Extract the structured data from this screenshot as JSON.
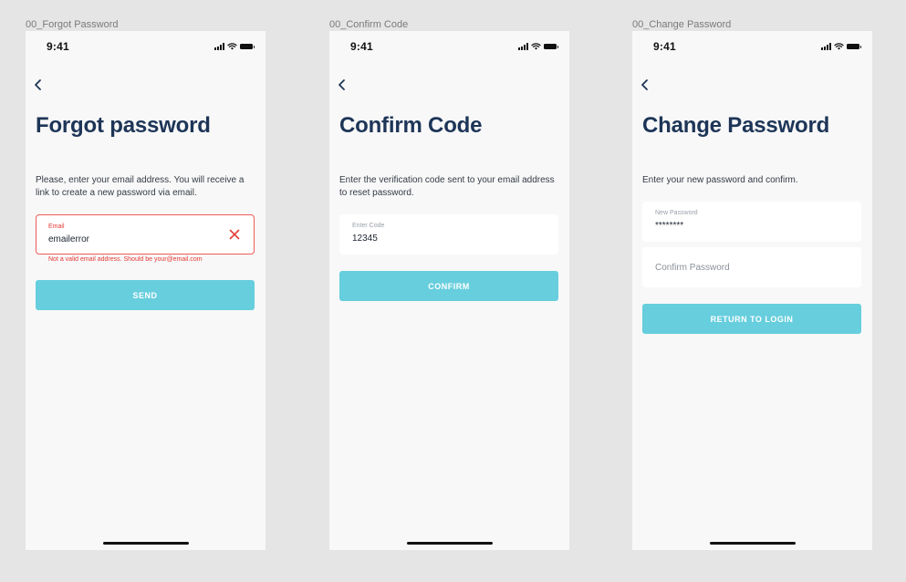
{
  "frames": [
    {
      "label": "00_Forgot Password",
      "time": "9:41",
      "title": "Forgot password",
      "description": "Please, enter your email address. You will receive a link to create a new password via email.",
      "email_field": {
        "label": "Email",
        "value": "emailerror"
      },
      "error_message": "Not a valid email address. Should be your@email.com",
      "button_label": "SEND"
    },
    {
      "label": "00_Confirm Code",
      "time": "9:41",
      "title": "Confirm Code",
      "description": "Enter the verification code sent to your email address to reset password.",
      "code_field": {
        "label": "Enter Code",
        "value": "12345"
      },
      "button_label": "CONFIRM"
    },
    {
      "label": "00_Change Password",
      "time": "9:41",
      "title": "Change Password",
      "description": "Enter your new password and confirm.",
      "new_password_field": {
        "label": "New Password",
        "value": "********"
      },
      "confirm_password_field": {
        "placeholder": "Confirm Password"
      },
      "button_label": "RETURN TO LOGIN"
    }
  ],
  "icons": {
    "back": "chevron-left-icon",
    "clear": "close-icon",
    "signal": "cellular-signal-icon",
    "wifi": "wifi-icon",
    "battery": "battery-icon"
  },
  "colors": {
    "title": "#1d3557",
    "button": "#67cedd",
    "error": "#e53935",
    "screen_background": "#f8f8f8",
    "canvas_background": "#e5e5e5"
  }
}
